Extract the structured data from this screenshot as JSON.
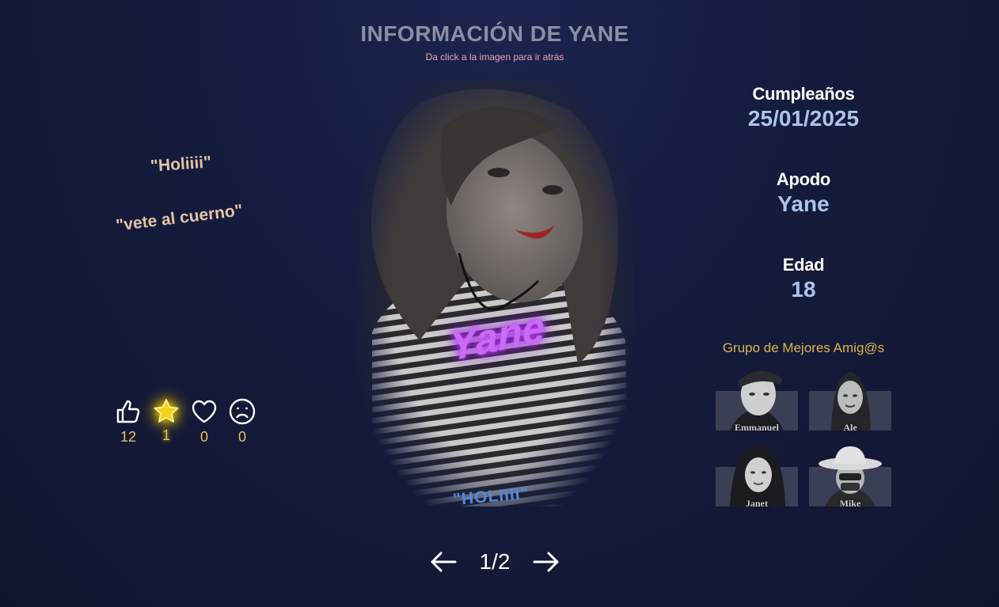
{
  "header": {
    "title": "INFORMACIÓN DE YANE",
    "subtitle": "Da click a la imagen para ir atrás"
  },
  "quotes": [
    "\"Holiiii\"",
    "\"vete al cuerno\""
  ],
  "reactions": [
    {
      "icon": "thumbs-up-icon",
      "count": "12"
    },
    {
      "icon": "star-icon",
      "count": "1"
    },
    {
      "icon": "heart-icon",
      "count": "0"
    },
    {
      "icon": "sad-face-icon",
      "count": "0"
    }
  ],
  "photo": {
    "overlay_name": "Yane",
    "caption": "\"HOLIIII\""
  },
  "info": {
    "birthday_label": "Cumpleaños",
    "birthday_value": "25/01/2025",
    "nickname_label": "Apodo",
    "nickname_value": "Yane",
    "age_label": "Edad",
    "age_value": "18"
  },
  "friends": {
    "title": "Grupo de Mejores Amig@s",
    "members": [
      "Emmanuel",
      "Ale",
      "Janet",
      "Mike"
    ]
  },
  "pager": {
    "page": "1/2"
  },
  "colors": {
    "background": "#151b3c",
    "accent_gold": "#d9b84a",
    "value_blue": "#a9c4ef",
    "neon_purple": "#c86cf4"
  }
}
